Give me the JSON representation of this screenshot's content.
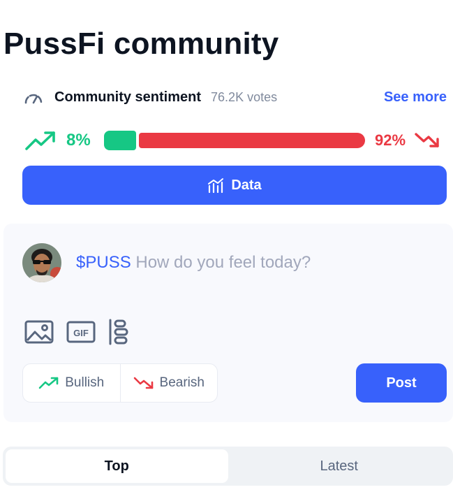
{
  "page": {
    "title": "PussFi community"
  },
  "sentiment": {
    "label": "Community sentiment",
    "votes": "76.2K votes",
    "see_more": "See more",
    "bullish_pct_label": "8%",
    "bearish_pct_label": "92%",
    "bullish_fraction": 0.08,
    "colors": {
      "bullish": "#16c784",
      "bearish": "#ea3943"
    }
  },
  "data_button": {
    "label": "Data",
    "icon": "chart-bars-icon"
  },
  "compose": {
    "ticker": "$PUSS",
    "placeholder": "How do you feel today?",
    "tools": [
      "image-icon",
      "gif-icon",
      "poll-icon"
    ],
    "bullish_label": "Bullish",
    "bearish_label": "Bearish",
    "post_label": "Post"
  },
  "tabs": [
    {
      "label": "Top",
      "active": true
    },
    {
      "label": "Latest",
      "active": false
    }
  ],
  "colors": {
    "accent": "#3861fb"
  }
}
